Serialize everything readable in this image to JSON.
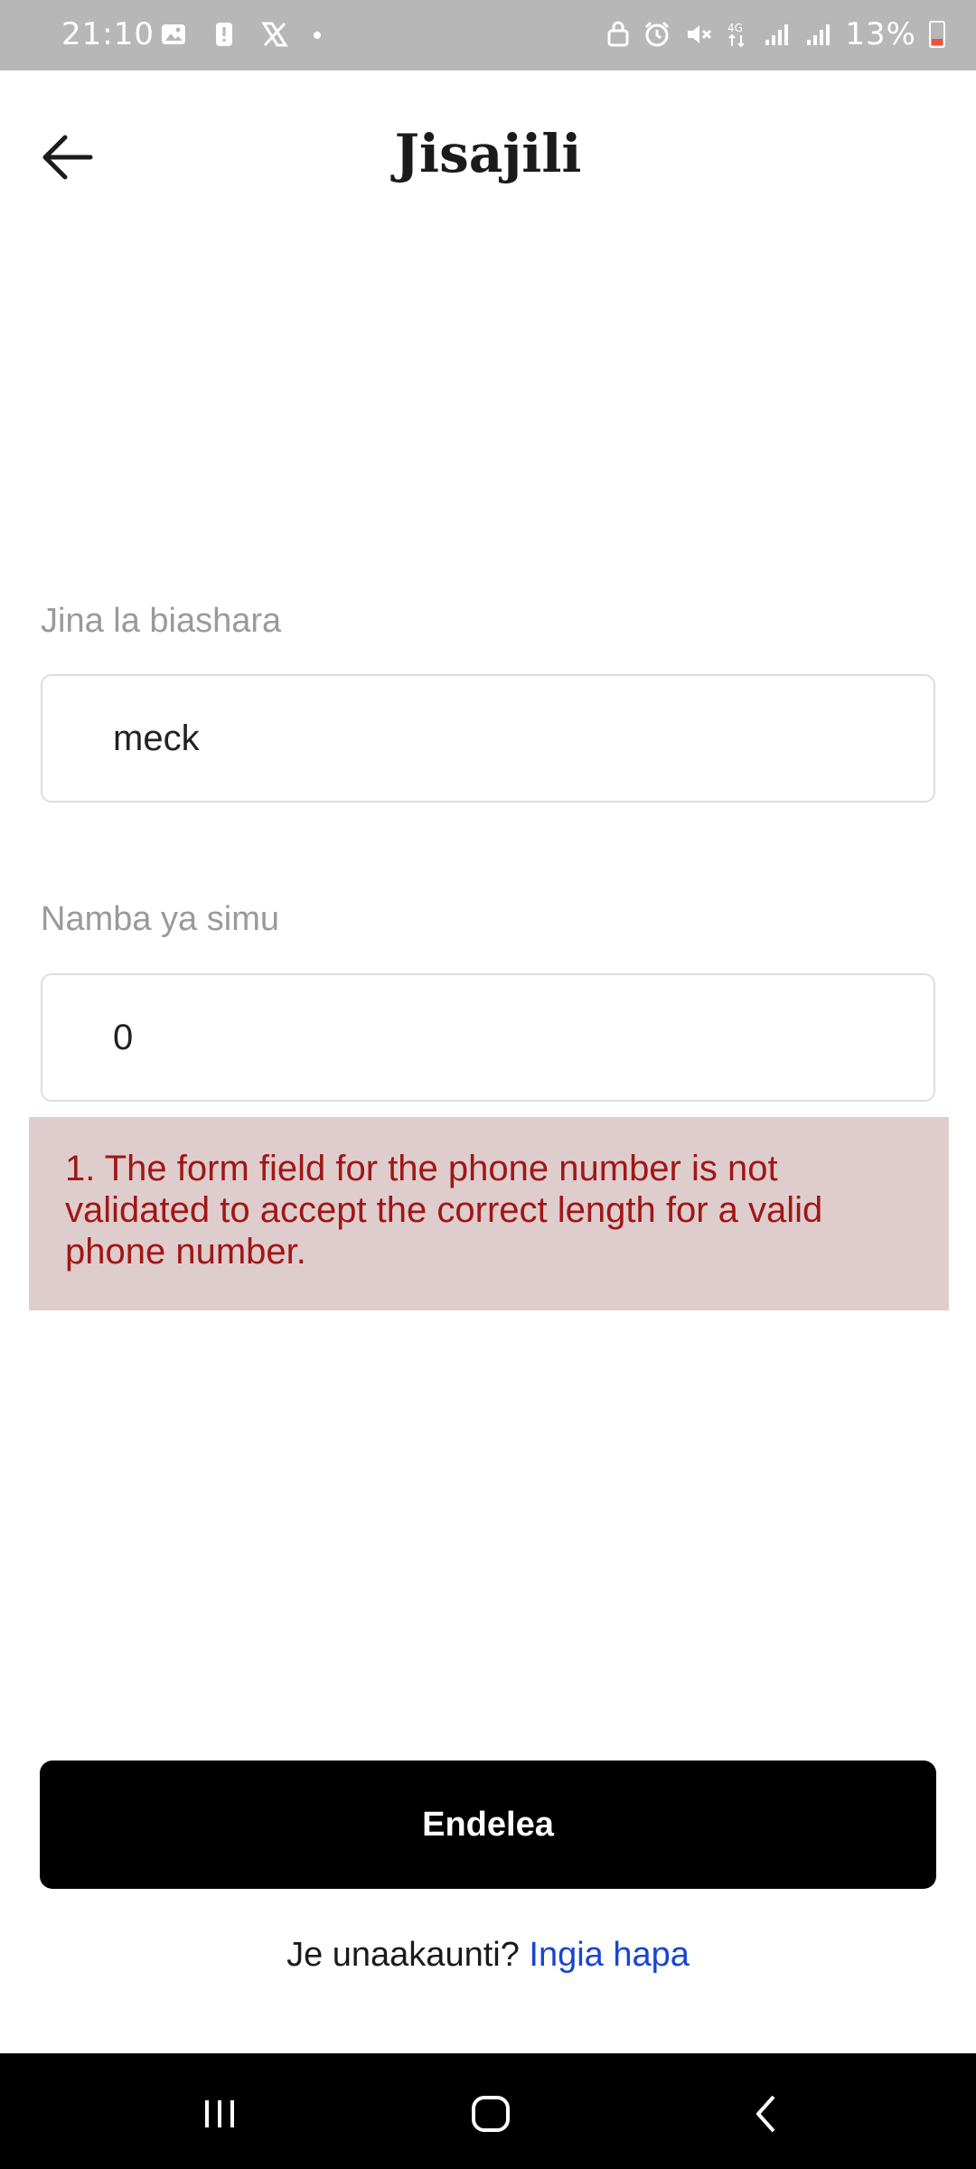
{
  "status_bar": {
    "time": "21:10",
    "battery_percent": "13%",
    "icons_left": [
      "image-icon",
      "alert-icon",
      "x-app-icon",
      "dot-icon"
    ],
    "icons_right": [
      "lock-icon",
      "alarm-icon",
      "mute-icon",
      "4g-data-icon",
      "signal-icon",
      "signal-icon",
      "battery-low-icon"
    ]
  },
  "header": {
    "title": "Jisajili",
    "back_icon": "arrow-left-icon"
  },
  "form": {
    "business_name_label": "Jina la biashara",
    "business_name_value": "meck",
    "phone_label": "Namba ya simu",
    "phone_value": "0",
    "error_message": "1. The form field for the phone number is not validated to accept the correct length for a valid phone number."
  },
  "actions": {
    "continue_label": "Endelea",
    "have_account_text": "Je unaakaunti?",
    "login_link": "Ingia hapa"
  },
  "nav_bar": {
    "items": [
      "recents-icon",
      "home-icon",
      "back-icon"
    ]
  },
  "colors": {
    "status_bar_bg": "#b7b7b7",
    "error_bg": "#dfcdcd",
    "error_text": "#a11616",
    "link": "#1845d1",
    "primary_button": "#000000"
  }
}
